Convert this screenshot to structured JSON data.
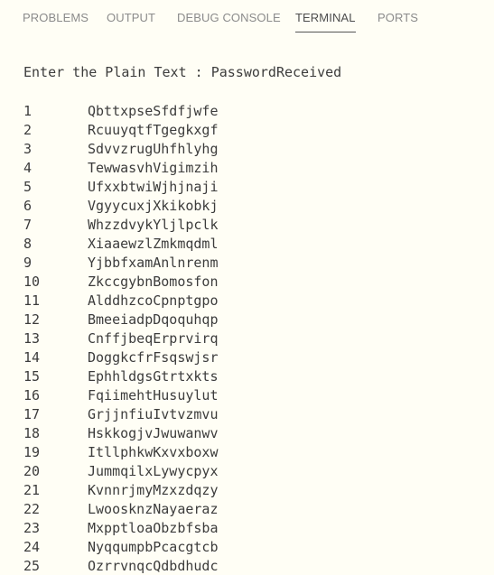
{
  "tabs": [
    {
      "label": "PROBLEMS",
      "active": false
    },
    {
      "label": "OUTPUT",
      "active": false
    },
    {
      "label": "DEBUG CONSOLE",
      "active": false
    },
    {
      "label": "TERMINAL",
      "active": true
    },
    {
      "label": "PORTS",
      "active": false
    }
  ],
  "terminal": {
    "prompt": "Enter the Plain Text : PasswordReceived",
    "rows": [
      {
        "num": "1",
        "text": "QbttxpseSfdfjwfe"
      },
      {
        "num": "2",
        "text": "RcuuyqtfTgegkxgf"
      },
      {
        "num": "3",
        "text": "SdvvzrugUhfhlyhg"
      },
      {
        "num": "4",
        "text": "TewwasvhVigimzih"
      },
      {
        "num": "5",
        "text": "UfxxbtwiWjhjnaji"
      },
      {
        "num": "6",
        "text": "VgyycuxjXkikobkj"
      },
      {
        "num": "7",
        "text": "WhzzdvykYljlpclk"
      },
      {
        "num": "8",
        "text": "XiaaewzlZmkmqdml"
      },
      {
        "num": "9",
        "text": "YjbbfxamAnlnrenm"
      },
      {
        "num": "10",
        "text": "ZkccgybnBomosfon"
      },
      {
        "num": "11",
        "text": "AlddhzcoCpnptgpo"
      },
      {
        "num": "12",
        "text": "BmeeiadpDqoquhqp"
      },
      {
        "num": "13",
        "text": "CnffjbeqErprvirq"
      },
      {
        "num": "14",
        "text": "DoggkcfrFsqswjsr"
      },
      {
        "num": "15",
        "text": "EphhldgsGtrtxkts"
      },
      {
        "num": "16",
        "text": "FqiimehtHusuylut"
      },
      {
        "num": "17",
        "text": "GrjjnfiuIvtvzmvu"
      },
      {
        "num": "18",
        "text": "HskkogjvJwuwanwv"
      },
      {
        "num": "19",
        "text": "ItllphkwKxvxboxw"
      },
      {
        "num": "20",
        "text": "JummqilxLywycpyx"
      },
      {
        "num": "21",
        "text": "KvnnrjmyMzxzdqzy"
      },
      {
        "num": "22",
        "text": "LwoosknzNayaeraz"
      },
      {
        "num": "23",
        "text": "MxpptloaObzbfsba"
      },
      {
        "num": "24",
        "text": "NyqqumpbPcacgtcb"
      },
      {
        "num": "25",
        "text": "OzrrvnqcQdbdhudc"
      }
    ]
  }
}
